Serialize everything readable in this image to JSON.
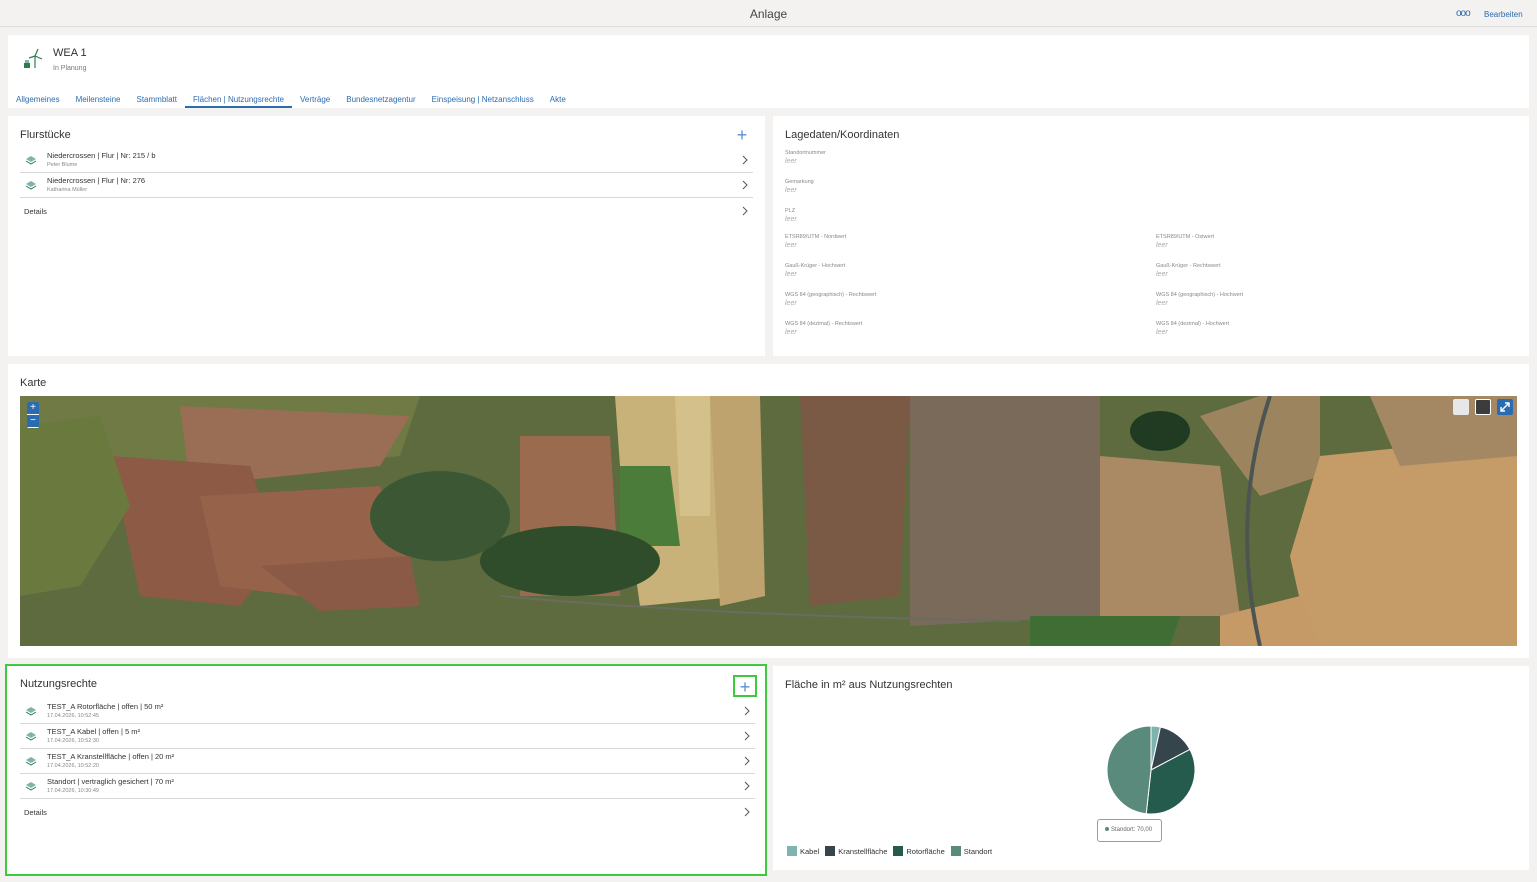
{
  "topbar": {
    "title": "Anlage",
    "more": "ooo",
    "edit": "Bearbeiten"
  },
  "header": {
    "name": "WEA 1",
    "status": "In Planung"
  },
  "tabs": [
    "Allgemeines",
    "Meilensteine",
    "Stammblatt",
    "Flächen | Nutzungsrechte",
    "Verträge",
    "Bundesnetzagentur",
    "Einspeisung | Netzanschluss",
    "Akte"
  ],
  "active_tab": "Flächen | Nutzungsrechte",
  "flurstuecke": {
    "title": "Flurstücke",
    "rows": [
      {
        "title": "Niedercrossen | Flur | Nr: 215 / b",
        "sub": "Peter Blume"
      },
      {
        "title": "Niedercrossen | Flur | Nr: 276",
        "sub": "Katharina Müller"
      }
    ],
    "details": "Details"
  },
  "lagedaten": {
    "title": "Lagedaten/Koordinaten",
    "empty": "leer",
    "fields": {
      "standort": "Standortnummer",
      "gemarkung": "Gemarkung",
      "plz": "PLZ",
      "etrs_nord": "ETSR89/UTM - Nordwert",
      "etrs_ost": "ETSR89/UTM - Ostwert",
      "gk_hoch": "Gauß-Krüger - Hochwert",
      "gk_rechts": "Gauß-Krüger - Rechtswert",
      "wgs_geo_rechts": "WGS 84 (geographisch) - Rechtswert",
      "wgs_geo_hoch": "WGS 84 (geographisch) - Hochwert",
      "wgs_dez_rechts": "WGS 84 (dezimal) - Rechtswert",
      "wgs_dez_hoch": "WGS 84 (dezimal) - Hochwert"
    }
  },
  "karte": {
    "title": "Karte",
    "zoom_in": "+",
    "zoom_out": "−"
  },
  "nutzungsrechte": {
    "title": "Nutzungsrechte",
    "rows": [
      {
        "title": "TEST_A Rotorfläche | offen | 50 m²",
        "sub": "17.04.2026, 10:52:45"
      },
      {
        "title": "TEST_A Kabel | offen | 5 m²",
        "sub": "17.04.2026, 10:52:30"
      },
      {
        "title": "TEST_A Kranstellfläche | offen | 20 m²",
        "sub": "17.04.2026, 10:52:20"
      },
      {
        "title": "Standort | vertraglich gesichert | 70 m²",
        "sub": "17.04.2026, 10:30:49"
      }
    ],
    "details": "Details"
  },
  "chart_panel": {
    "title": "Fläche in m² aus Nutzungsrechten",
    "tooltip": "Standort: 70,00"
  },
  "chart_data": {
    "type": "pie",
    "title": "Fläche in m² aus Nutzungsrechten",
    "categories": [
      "Kabel",
      "Kranstellfläche",
      "Rotorfläche",
      "Standort"
    ],
    "values": [
      5,
      20,
      50,
      70
    ],
    "colors": [
      "#7fb3b0",
      "#36454c",
      "#255b4d",
      "#5a8a7c"
    ],
    "legend": "bottom-left"
  },
  "colors": {
    "accent": "#2b6cb0",
    "highlight": "#3ec93e"
  }
}
